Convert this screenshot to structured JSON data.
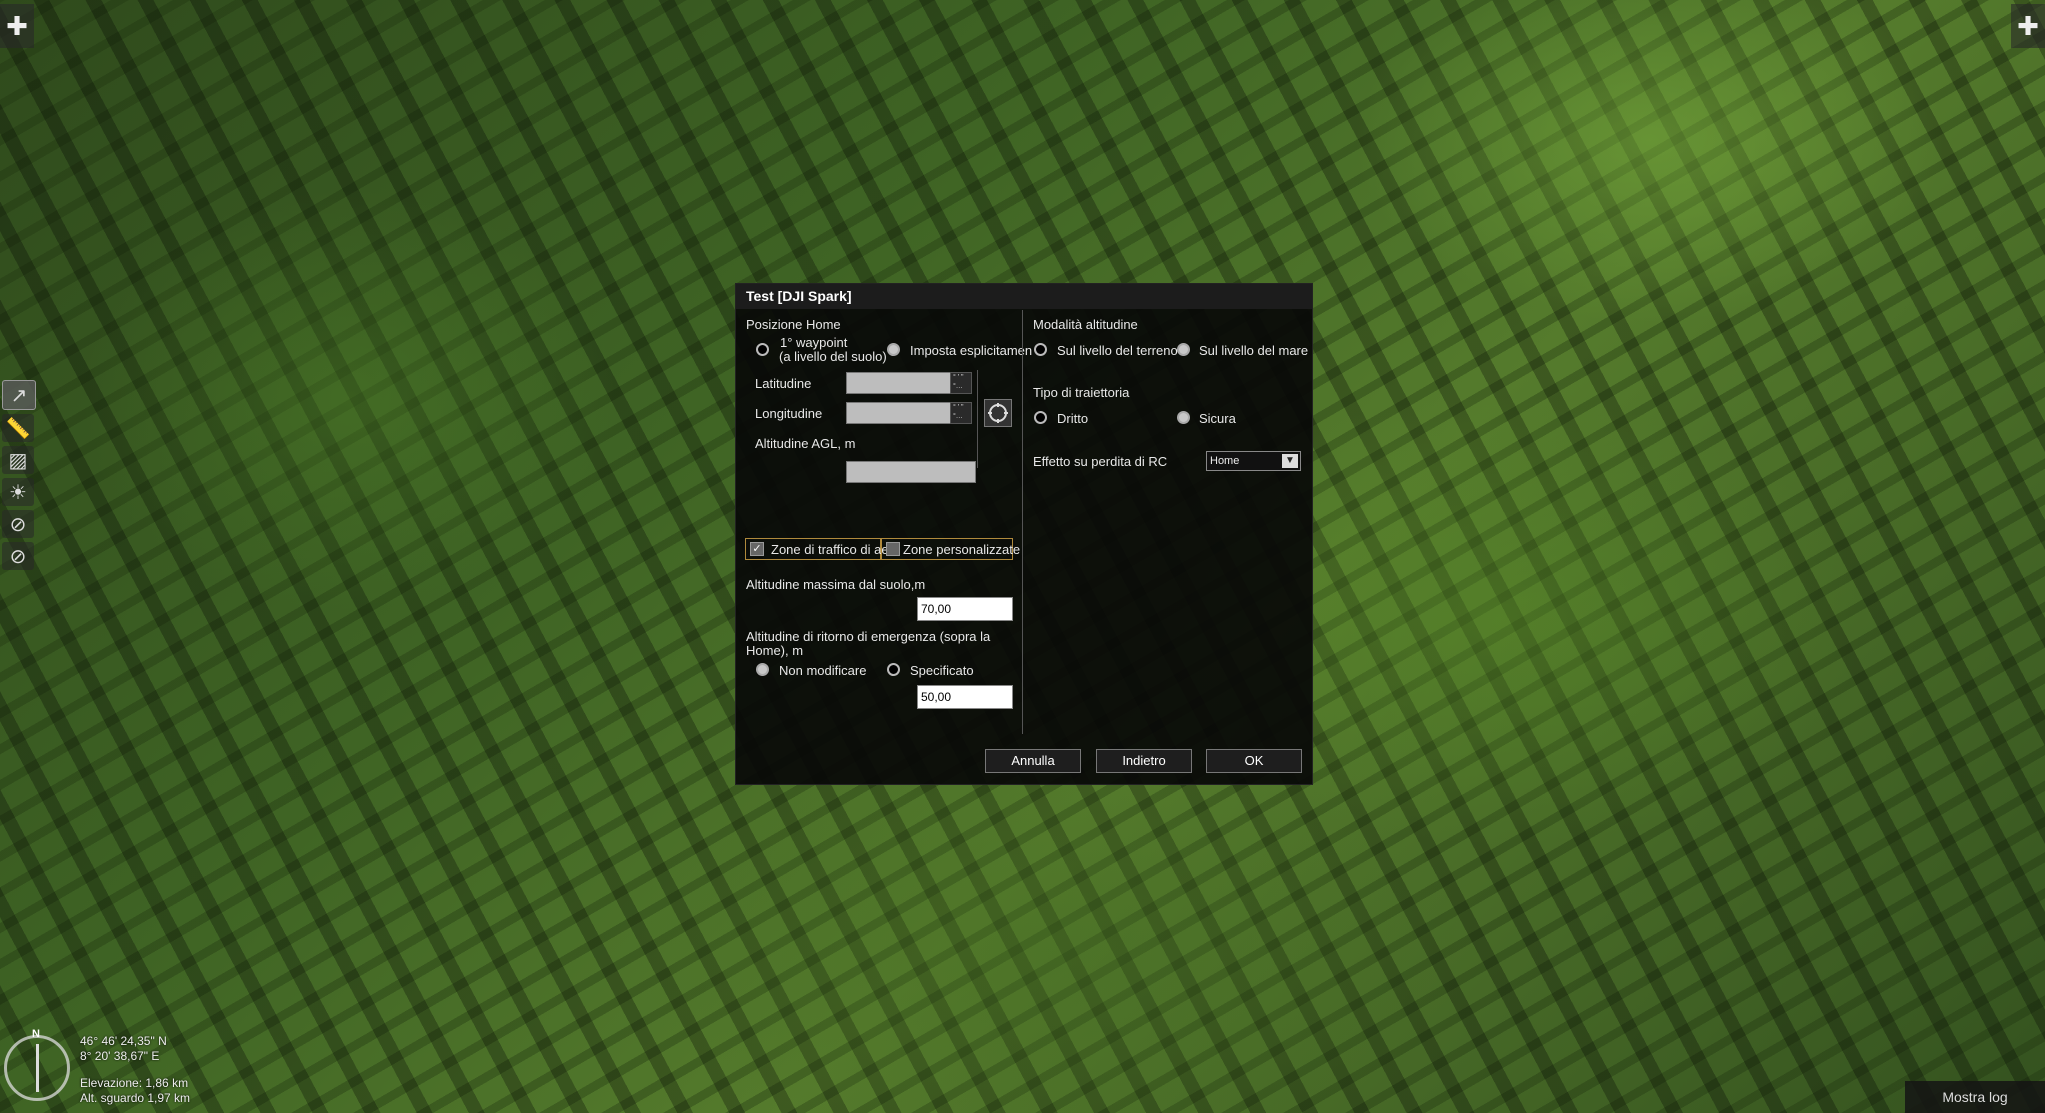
{
  "map": {
    "coords_lat": "46° 46' 24,35\" N",
    "coords_lon": "8° 20' 38,67\" E",
    "elevation": "Elevazione: 1,86 km",
    "eye_alt": "Alt. sguardo 1,97 km",
    "compass_north": "N",
    "show_log": "Mostra log"
  },
  "dialog": {
    "title": "Test [DJI Spark]",
    "home_position_label": "Posizione Home",
    "home_first_waypoint_line1": "1° waypoint",
    "home_first_waypoint_line2": "(a livello del suolo)",
    "home_explicit": "Imposta esplicitamente",
    "latitude_label": "Latitudine",
    "longitude_label": "Longitudine",
    "altitude_agl_label": "Altitudine AGL, m",
    "mini_fmt_top": "° ' \"",
    "mini_fmt_bottom": "°…",
    "air_traffic_zones": "Zone di traffico di aeroporto",
    "custom_zones": "Zone personalizzate",
    "max_altitude_label": "Altitudine massima dal suolo,m",
    "max_altitude_value": "70,00",
    "rth_altitude_label_1": "Altitudine di ritorno di emergenza (sopra la",
    "rth_altitude_label_2": "Home), m",
    "rth_no_change": "Non modificare",
    "rth_specified": "Specificato",
    "rth_value": "50,00",
    "altitude_mode_label": "Modalità altitudine",
    "alt_mode_terrain": "Sul livello del terreno",
    "alt_mode_sea": "Sul livello del mare",
    "trajectory_label": "Tipo di traiettoria",
    "traj_straight": "Dritto",
    "traj_safe": "Sicura",
    "rc_loss_label": "Effetto su perdita di RC",
    "rc_loss_value": "Home",
    "btn_cancel": "Annulla",
    "btn_back": "Indietro",
    "btn_ok": "OK"
  },
  "icons": {
    "top_left": "plus-tool-icon",
    "top_right": "plus-tool-icon",
    "tools": [
      "route-icon",
      "ruler-icon",
      "polygon-icon",
      "sun-icon",
      "no-fly-icon",
      "no-fly-icon"
    ]
  }
}
